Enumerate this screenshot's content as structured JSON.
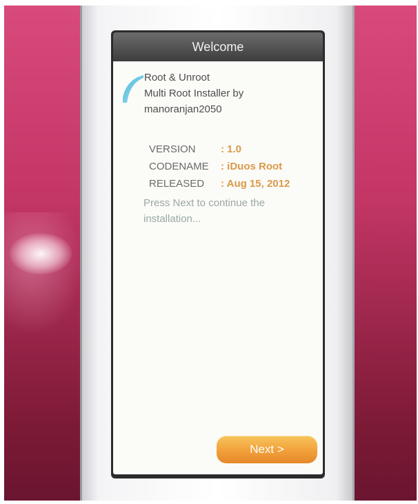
{
  "window": {
    "title": "Welcome"
  },
  "app": {
    "title_lines": [
      "Root & Unroot",
      "Multi Root Installer by",
      "manoranjan2050"
    ],
    "logo_icon": "quarter-circle-logo-icon"
  },
  "info": [
    {
      "label": "VERSION",
      "value": ": 1.0"
    },
    {
      "label": "CODENAME",
      "value": ": iDuos Root"
    },
    {
      "label": "RELEASED",
      "value": ": Aug 15, 2012"
    }
  ],
  "instruction": {
    "line1": "Press Next to continue the",
    "line2": "installation..."
  },
  "buttons": {
    "next_label": "Next >"
  },
  "colors": {
    "accent": "#f2a03a",
    "value_text": "#d99a4a",
    "background": "#c23565"
  }
}
